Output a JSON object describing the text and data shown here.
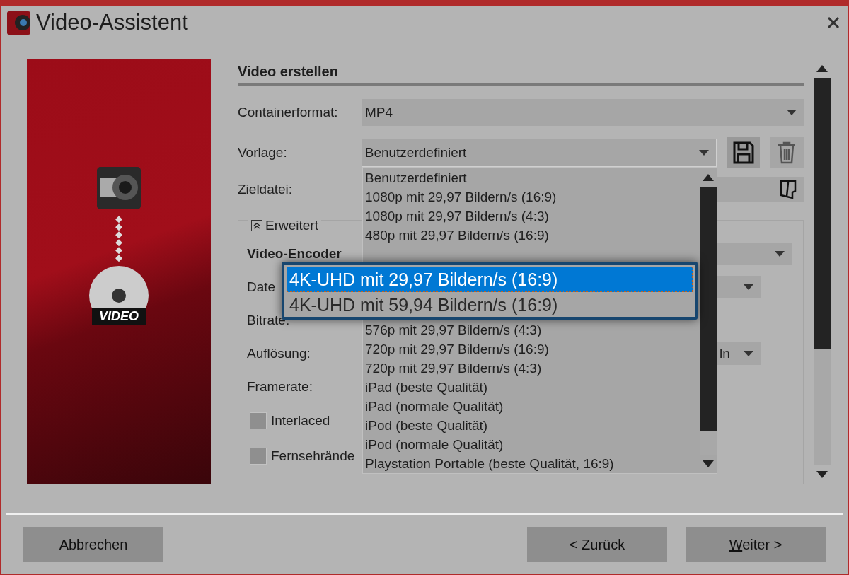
{
  "window": {
    "title": "Video-Assistent"
  },
  "left_panel": {
    "disc_label": "VIDEO"
  },
  "section_title": "Video erstellen",
  "fields": [
    {
      "kind": "select",
      "label": "Containerformat:",
      "value": "MP4"
    },
    {
      "kind": "template",
      "label": "Vorlage:",
      "value": "Benutzerdefiniert"
    },
    {
      "kind": "file",
      "label": "Zieldatei:"
    }
  ],
  "advanced": {
    "label": "Erweitert",
    "expanded": true,
    "rows": [
      {
        "kind": "heading",
        "label": "Video-Encoder",
        "dropdown": true
      },
      {
        "kind": "label",
        "label": "Date",
        "dropdown": true
      },
      {
        "kind": "label",
        "label": "Bitrate:"
      },
      {
        "kind": "label",
        "label": "Auflösung:",
        "dropdown": true,
        "value": "ln"
      },
      {
        "kind": "label",
        "label": "Framerate:"
      }
    ],
    "checkboxes": [
      {
        "label": "Interlaced",
        "checked": false
      },
      {
        "label": "Fernsehrände",
        "checked": false
      }
    ]
  },
  "template_list": {
    "items_above": [
      "Benutzerdefiniert",
      "1080p mit 29,97 Bildern/s (16:9)",
      "1080p mit 29,97 Bildern/s (4:3)",
      "480p mit 29,97 Bildern/s (16:9)"
    ],
    "items_below": [
      "576p mit 29,97 Bildern/s (4:3)",
      "720p mit 29,97 Bildern/s (16:9)",
      "720p mit 29,97 Bildern/s (4:3)",
      "iPad (beste Qualität)",
      "iPad (normale Qualität)",
      "iPod (beste Qualität)",
      "iPod (normale Qualität)",
      "Playstation Portable (beste Qualität, 16:9)"
    ]
  },
  "magnifier": {
    "items": [
      {
        "label": "4K-UHD mit 29,97 Bildern/s (16:9)",
        "selected": true
      },
      {
        "label": "4K-UHD mit 59,94 Bildern/s (16:9)",
        "selected": false
      }
    ]
  },
  "buttons": [
    {
      "kind": "left",
      "label": "Abbrechen"
    },
    {
      "kind": "right",
      "label": "< Zurück"
    },
    {
      "kind": "right",
      "mnemonic": "W",
      "label": "eiter >"
    }
  ]
}
